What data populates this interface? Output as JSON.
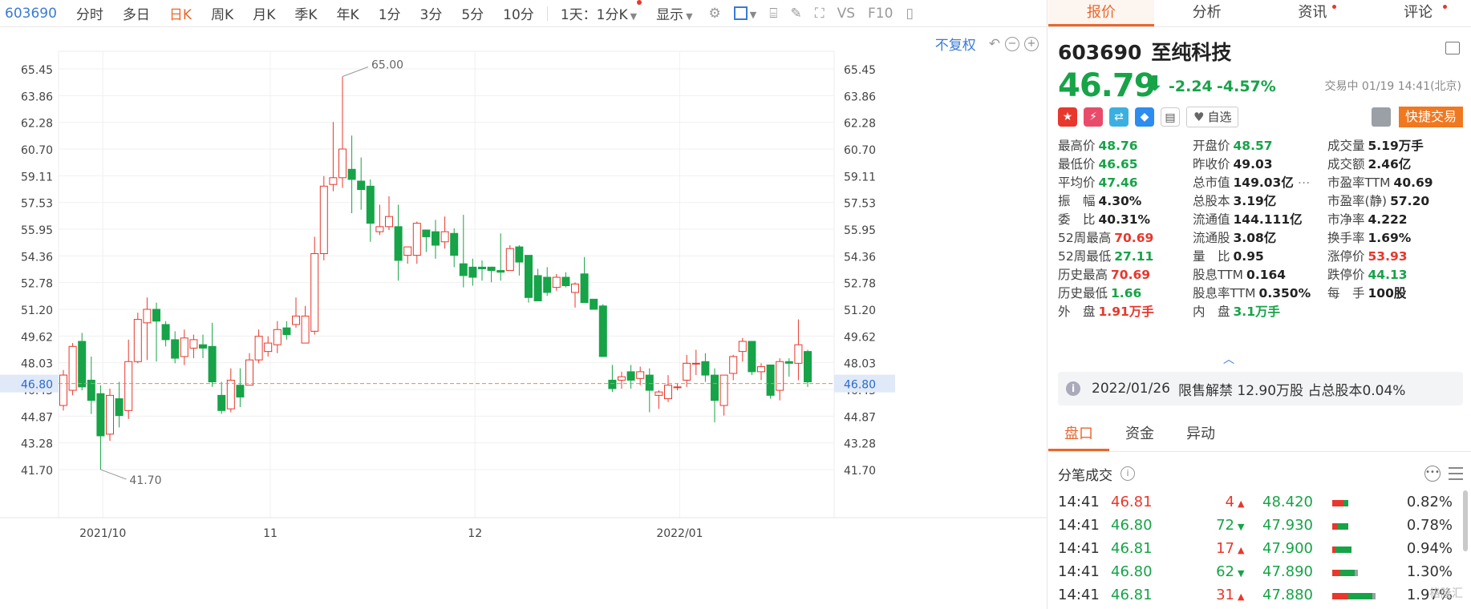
{
  "toolbar": {
    "code": "603690",
    "items": [
      "分时",
      "多日",
      "日K",
      "周K",
      "月K",
      "季K",
      "年K",
      "1分",
      "3分",
      "5分",
      "10分"
    ],
    "active": "日K",
    "range": "1天：1分K",
    "display": "显示",
    "vs": "VS",
    "f10": "F10"
  },
  "chart": {
    "restore_label": "不复权",
    "current_price_tag": "46.80",
    "high_label": "65.00",
    "low_label": "41.70",
    "colors": {
      "up": "#e8372c",
      "down": "#17a348",
      "grid": "#f0f0f0"
    }
  },
  "chart_data": {
    "type": "candlestick",
    "y_ticks": [
      "65.45",
      "63.86",
      "62.28",
      "60.70",
      "59.11",
      "57.53",
      "55.95",
      "54.36",
      "52.78",
      "51.20",
      "49.62",
      "48.03",
      "46.45",
      "44.87",
      "43.28",
      "41.70"
    ],
    "ylim": [
      41.7,
      65.45
    ],
    "x_labels": [
      {
        "label": "2021/10",
        "index": 2
      },
      {
        "label": "11",
        "index": 20
      },
      {
        "label": "12",
        "index": 42
      },
      {
        "label": "2022/01",
        "index": 64
      }
    ],
    "reference_price": 46.8,
    "candles": [
      [
        45.5,
        47.3,
        45.2,
        47.6
      ],
      [
        46.4,
        49.0,
        46.1,
        49.2
      ],
      [
        49.3,
        46.6,
        46.4,
        49.8
      ],
      [
        47.0,
        45.8,
        45.0,
        48.4
      ],
      [
        46.2,
        43.7,
        41.7,
        46.7
      ],
      [
        43.8,
        46.1,
        43.4,
        46.5
      ],
      [
        45.9,
        44.9,
        44.2,
        46.9
      ],
      [
        45.2,
        48.1,
        44.7,
        49.4
      ],
      [
        48.1,
        50.6,
        48.0,
        51.0
      ],
      [
        50.4,
        51.2,
        48.2,
        51.9
      ],
      [
        51.2,
        50.5,
        48.1,
        51.6
      ],
      [
        50.3,
        49.4,
        49.0,
        50.5
      ],
      [
        49.4,
        48.3,
        48.0,
        49.9
      ],
      [
        48.4,
        49.5,
        47.9,
        50.0
      ],
      [
        48.9,
        49.4,
        48.3,
        49.7
      ],
      [
        49.1,
        48.9,
        48.3,
        49.7
      ],
      [
        49.0,
        46.9,
        46.6,
        50.4
      ],
      [
        46.1,
        45.2,
        45.0,
        46.9
      ],
      [
        45.3,
        47.0,
        45.1,
        47.7
      ],
      [
        46.7,
        46.0,
        45.4,
        47.7
      ],
      [
        46.7,
        48.2,
        46.7,
        48.6
      ],
      [
        48.2,
        49.6,
        48.0,
        50.0
      ],
      [
        48.7,
        49.2,
        48.4,
        49.6
      ],
      [
        49.1,
        50.0,
        48.6,
        50.5
      ],
      [
        50.1,
        49.7,
        49.4,
        50.5
      ],
      [
        50.3,
        50.8,
        50.1,
        51.9
      ],
      [
        49.2,
        50.8,
        49.2,
        51.4
      ],
      [
        49.9,
        54.5,
        49.7,
        55.5
      ],
      [
        54.5,
        58.5,
        54.1,
        59.1
      ],
      [
        58.6,
        59.0,
        58.2,
        62.3
      ],
      [
        59.0,
        60.7,
        58.4,
        65.0
      ],
      [
        59.5,
        58.9,
        56.9,
        61.5
      ],
      [
        58.8,
        58.3,
        57.1,
        60.2
      ],
      [
        58.5,
        56.3,
        55.2,
        58.9
      ],
      [
        55.8,
        56.1,
        55.6,
        57.4
      ],
      [
        56.1,
        56.7,
        55.9,
        57.9
      ],
      [
        56.1,
        54.1,
        52.9,
        57.4
      ],
      [
        54.4,
        54.9,
        53.9,
        54.7
      ],
      [
        54.4,
        56.3,
        53.9,
        56.4
      ],
      [
        55.9,
        55.5,
        54.6,
        55.9
      ],
      [
        55.8,
        55.0,
        54.2,
        56.5
      ],
      [
        55.2,
        55.8,
        54.8,
        56.7
      ],
      [
        55.7,
        54.4,
        53.7,
        56.0
      ],
      [
        53.9,
        53.2,
        52.5,
        56.8
      ],
      [
        53.7,
        53.1,
        52.6,
        54.2
      ],
      [
        53.7,
        53.6,
        52.9,
        54.1
      ],
      [
        53.7,
        53.5,
        52.8,
        53.6
      ],
      [
        53.5,
        53.4,
        52.9,
        55.7
      ],
      [
        53.5,
        54.8,
        53.5,
        55.0
      ],
      [
        54.9,
        54.0,
        53.2,
        55.0
      ],
      [
        54.4,
        51.9,
        51.6,
        54.4
      ],
      [
        53.2,
        51.7,
        51.7,
        53.6
      ],
      [
        53.1,
        52.2,
        52.0,
        53.7
      ],
      [
        52.5,
        53.1,
        52.3,
        53.3
      ],
      [
        53.1,
        52.6,
        52.5,
        53.4
      ],
      [
        52.2,
        52.7,
        51.3,
        52.8
      ],
      [
        53.3,
        51.6,
        51.7,
        54.3
      ],
      [
        51.8,
        51.2,
        51.2,
        51.8
      ],
      [
        51.4,
        48.4,
        48.5,
        51.5
      ],
      [
        47.0,
        46.5,
        46.3,
        47.9
      ],
      [
        47.0,
        47.2,
        46.5,
        47.5
      ],
      [
        47.5,
        47.0,
        46.5,
        47.9
      ],
      [
        47.1,
        47.5,
        46.7,
        47.8
      ],
      [
        47.3,
        46.4,
        45.1,
        47.7
      ],
      [
        46.1,
        46.3,
        45.3,
        46.4
      ],
      [
        45.9,
        46.7,
        45.7,
        47.3
      ],
      [
        46.6,
        46.6,
        46.4,
        46.8
      ],
      [
        47.0,
        48.0,
        46.6,
        48.5
      ],
      [
        48.0,
        48.0,
        47.3,
        48.8
      ],
      [
        48.1,
        47.3,
        46.9,
        48.6
      ],
      [
        47.3,
        45.8,
        44.5,
        47.7
      ],
      [
        45.5,
        47.3,
        44.9,
        47.3
      ],
      [
        47.4,
        48.4,
        47.0,
        48.5
      ],
      [
        48.7,
        49.3,
        48.1,
        49.5
      ],
      [
        49.3,
        47.5,
        47.3,
        49.0
      ],
      [
        47.5,
        47.8,
        47.0,
        48.0
      ],
      [
        47.9,
        46.1,
        45.9,
        47.9
      ],
      [
        46.4,
        48.1,
        45.8,
        48.3
      ],
      [
        48.1,
        48.0,
        47.2,
        48.3
      ],
      [
        48.0,
        49.1,
        47.0,
        50.6
      ],
      [
        48.7,
        46.9,
        46.6,
        48.8
      ]
    ]
  },
  "right": {
    "tabs": [
      "报价",
      "分析",
      "资讯",
      "评论"
    ],
    "code": "603690",
    "name": "至纯科技",
    "price": "46.79",
    "arrow": "⬇",
    "change": "-2.24",
    "pct": "-4.57%",
    "status": "交易中 01/19 14:41(北京)",
    "fav_label": "自选",
    "quick_trade": "快捷交易",
    "quote_rows": [
      [
        {
          "l": "最高价",
          "v": "48.76",
          "c": "dn"
        },
        {
          "l": "开盘价",
          "v": "48.57",
          "c": "dn"
        },
        {
          "l": "成交量",
          "v": "5.19万手",
          "c": ""
        }
      ],
      [
        {
          "l": "最低价",
          "v": "46.65",
          "c": "dn"
        },
        {
          "l": "昨收价",
          "v": "49.03",
          "c": ""
        },
        {
          "l": "成交额",
          "v": "2.46亿",
          "c": ""
        }
      ],
      [
        {
          "l": "平均价",
          "v": "47.46",
          "c": "dn"
        },
        {
          "l": "总市值",
          "v": "149.03亿",
          "c": ""
        },
        {
          "l": "市盈率TTM",
          "v": "40.69",
          "c": ""
        }
      ],
      [
        {
          "l": "振　幅",
          "v": "4.30%",
          "c": ""
        },
        {
          "l": "总股本",
          "v": "3.19亿",
          "c": ""
        },
        {
          "l": "市盈率(静)",
          "v": "57.20",
          "c": ""
        }
      ],
      [
        {
          "l": "委　比",
          "v": "40.31%",
          "c": ""
        },
        {
          "l": "流通值",
          "v": "144.111亿",
          "c": ""
        },
        {
          "l": "市净率",
          "v": "4.222",
          "c": ""
        }
      ],
      [
        {
          "l": "52周最高",
          "v": "70.69",
          "c": "up"
        },
        {
          "l": "流通股",
          "v": "3.08亿",
          "c": ""
        },
        {
          "l": "换手率",
          "v": "1.69%",
          "c": ""
        }
      ],
      [
        {
          "l": "52周最低",
          "v": "27.11",
          "c": "dn"
        },
        {
          "l": "量　比",
          "v": "0.95",
          "c": ""
        },
        {
          "l": "涨停价",
          "v": "53.93",
          "c": "up"
        }
      ],
      [
        {
          "l": "历史最高",
          "v": "70.69",
          "c": "up"
        },
        {
          "l": "股息TTM",
          "v": "0.164",
          "c": ""
        },
        {
          "l": "跌停价",
          "v": "44.13",
          "c": "dn"
        }
      ],
      [
        {
          "l": "历史最低",
          "v": "1.66",
          "c": "dn"
        },
        {
          "l": "股息率TTM",
          "v": "0.350%",
          "c": ""
        },
        {
          "l": "每　手",
          "v": "100股",
          "c": ""
        }
      ],
      [
        {
          "l": "外　盘",
          "v": "1.91万手",
          "c": "up"
        },
        {
          "l": "内　盘",
          "v": "3.1万手",
          "c": "dn"
        },
        {
          "l": "",
          "v": "",
          "c": ""
        }
      ]
    ],
    "notice": {
      "date": "2022/01/26",
      "text": "限售解禁 12.90万股 占总股本0.04%"
    },
    "sub_tabs": [
      "盘口",
      "资金",
      "异动"
    ],
    "ticks_title": "分笔成交",
    "ticks": [
      {
        "time": "14:41",
        "price": "46.81",
        "pc": "up",
        "vol": "4",
        "dir": "▲",
        "dc": "up",
        "p2": "48.420",
        "pct": "0.82%",
        "bar": [
          14,
          6,
          0
        ]
      },
      {
        "time": "14:41",
        "price": "46.80",
        "pc": "dn",
        "vol": "72",
        "dir": "▼",
        "dc": "dn",
        "p2": "47.930",
        "pct": "0.78%",
        "bar": [
          6,
          14,
          0
        ]
      },
      {
        "time": "14:41",
        "price": "46.81",
        "pc": "dn",
        "vol": "17",
        "dir": "▲",
        "dc": "up",
        "p2": "47.900",
        "pct": "0.94%",
        "bar": [
          4,
          20,
          0
        ]
      },
      {
        "time": "14:41",
        "price": "46.80",
        "pc": "dn",
        "vol": "62",
        "dir": "▼",
        "dc": "dn",
        "p2": "47.890",
        "pct": "1.30%",
        "bar": [
          10,
          18,
          4
        ]
      },
      {
        "time": "14:41",
        "price": "46.81",
        "pc": "dn",
        "vol": "31",
        "dir": "▲",
        "dc": "up",
        "p2": "47.880",
        "pct": "1.97%",
        "bar": [
          20,
          30,
          4
        ]
      }
    ],
    "watermark": "格隆汇"
  }
}
